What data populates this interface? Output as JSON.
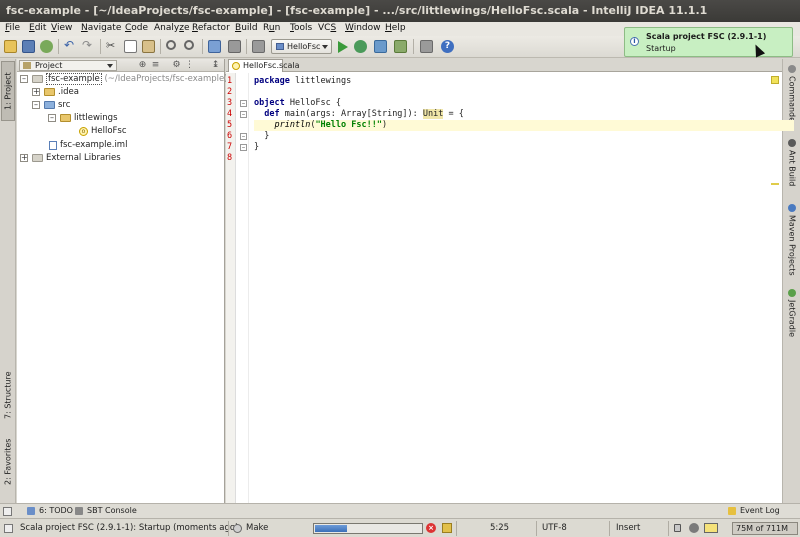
{
  "window": {
    "title": "fsc-example - [~/IdeaProjects/fsc-example] - [fsc-example] - .../src/littlewings/HelloFsc.scala - IntelliJ IDEA 11.1.1"
  },
  "menu": [
    {
      "pre": "",
      "u": "F",
      "post": "ile"
    },
    {
      "pre": "",
      "u": "E",
      "post": "dit"
    },
    {
      "pre": "",
      "u": "V",
      "post": "iew"
    },
    {
      "pre": "",
      "u": "N",
      "post": "avigate"
    },
    {
      "pre": "",
      "u": "C",
      "post": "ode"
    },
    {
      "pre": "Analy",
      "u": "z",
      "post": "e"
    },
    {
      "pre": "",
      "u": "R",
      "post": "efactor"
    },
    {
      "pre": "",
      "u": "B",
      "post": "uild"
    },
    {
      "pre": "R",
      "u": "u",
      "post": "n"
    },
    {
      "pre": "",
      "u": "T",
      "post": "ools"
    },
    {
      "pre": "VC",
      "u": "S",
      "post": ""
    },
    {
      "pre": "",
      "u": "W",
      "post": "indow"
    },
    {
      "pre": "",
      "u": "H",
      "post": "elp"
    }
  ],
  "toolbar": {
    "run_config": "HelloFsc"
  },
  "notification": {
    "title": "Scala project FSC (2.9.1-1)",
    "message": "Startup"
  },
  "left_tabs": {
    "project": "1: Project",
    "structure": "7: Structure",
    "favorites": "2: Favorites"
  },
  "right_tabs": {
    "commander": "Commander",
    "ant": "Ant Build",
    "maven": "Maven Projects",
    "gradle": "JetGradle"
  },
  "project_panel": {
    "selector": "Project",
    "tree": {
      "root_name": "fsc-example",
      "root_path": "(~/IdeaProjects/fsc-example)",
      "idea": ".idea",
      "src": "src",
      "pkg": "littlewings",
      "file": "HelloFsc",
      "iml": "fsc-example.iml",
      "libs": "External Libraries"
    }
  },
  "editor": {
    "tab": "HelloFsc.scala",
    "lines": [
      "1",
      "2",
      "3",
      "4",
      "5",
      "6",
      "7",
      "8"
    ],
    "code": {
      "l1_kw": "package",
      "l1_rest": " littlewings",
      "l3_kw": "object",
      "l3_rest": " HelloFsc {",
      "l4_indent": "  ",
      "l4_kw": "def",
      "l4_rest": " main(args: Array[String]): ",
      "l4_unit": "Unit",
      "l4_end": " = {",
      "l5_indent": "    ",
      "l5_fn": "println",
      "l5_open": "(",
      "l5_str": "\"Hello Fsc!!\"",
      "l5_close": ")",
      "l6": "  }",
      "l7": "}"
    }
  },
  "bottom_tools": {
    "todo": "6: TODO",
    "sbt": "SBT Console",
    "event_log": "Event Log"
  },
  "status": {
    "message": "Scala project FSC (2.9.1-1): Startup (moments ago)",
    "task": "Make",
    "progress": 0.3,
    "position": "5:25",
    "encoding": "UTF-8",
    "mode": "Insert",
    "memory": "75M of 711M"
  }
}
